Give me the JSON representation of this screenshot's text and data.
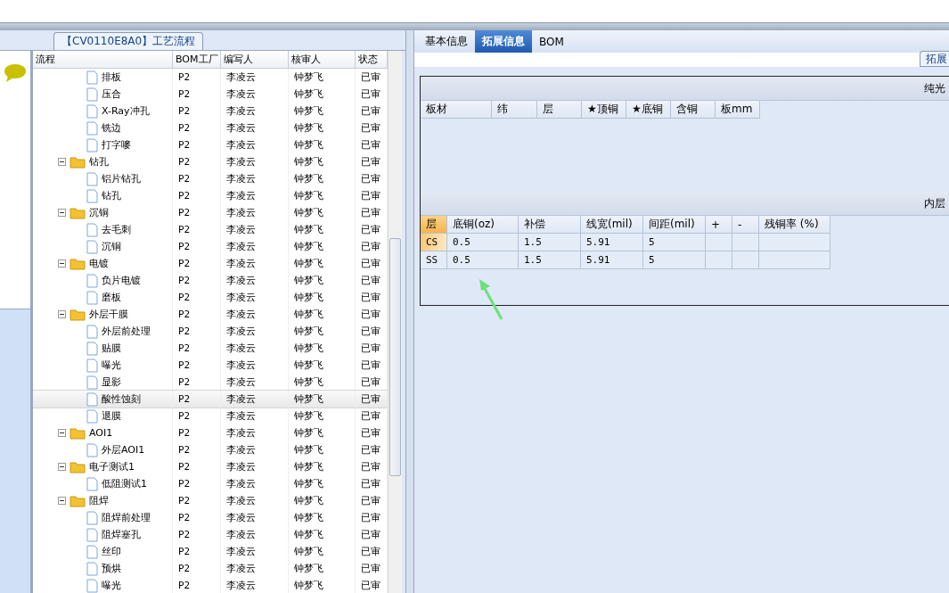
{
  "left_panel": {
    "title": "【CV0110E8A0】工艺流程",
    "columns": [
      "流程",
      "BOM工厂",
      "编写人",
      "核审人",
      "状态"
    ],
    "rows": [
      {
        "kind": "file",
        "label": "排板",
        "bom": "P2",
        "writer": "李凌云",
        "reviewer": "钟梦飞",
        "status": "已审",
        "selected": false
      },
      {
        "kind": "file",
        "label": "压合",
        "bom": "P2",
        "writer": "李凌云",
        "reviewer": "钟梦飞",
        "status": "已审",
        "selected": false
      },
      {
        "kind": "file",
        "label": "X-Ray冲孔",
        "bom": "P2",
        "writer": "李凌云",
        "reviewer": "钟梦飞",
        "status": "已审",
        "selected": false
      },
      {
        "kind": "file",
        "label": "铣边",
        "bom": "P2",
        "writer": "李凌云",
        "reviewer": "钟梦飞",
        "status": "已审",
        "selected": false
      },
      {
        "kind": "file",
        "label": "打字嘜",
        "bom": "P2",
        "writer": "李凌云",
        "reviewer": "钟梦飞",
        "status": "已审",
        "selected": false
      },
      {
        "kind": "folder",
        "label": "钻孔",
        "bom": "P2",
        "writer": "李凌云",
        "reviewer": "钟梦飞",
        "status": "已审",
        "selected": false,
        "expanded": true,
        "children": [
          {
            "kind": "file",
            "label": "铝片钻孔",
            "bom": "P2",
            "writer": "李凌云",
            "reviewer": "钟梦飞",
            "status": "已审",
            "selected": false
          },
          {
            "kind": "file",
            "label": "钻孔",
            "bom": "P2",
            "writer": "李凌云",
            "reviewer": "钟梦飞",
            "status": "已审",
            "selected": false
          }
        ]
      },
      {
        "kind": "folder",
        "label": "沉铜",
        "bom": "P2",
        "writer": "李凌云",
        "reviewer": "钟梦飞",
        "status": "已审",
        "selected": false,
        "expanded": true,
        "children": [
          {
            "kind": "file",
            "label": "去毛刺",
            "bom": "P2",
            "writer": "李凌云",
            "reviewer": "钟梦飞",
            "status": "已审",
            "selected": false
          },
          {
            "kind": "file",
            "label": "沉铜",
            "bom": "P2",
            "writer": "李凌云",
            "reviewer": "钟梦飞",
            "status": "已审",
            "selected": false
          }
        ]
      },
      {
        "kind": "folder",
        "label": "电镀",
        "bom": "P2",
        "writer": "李凌云",
        "reviewer": "钟梦飞",
        "status": "已审",
        "selected": false,
        "expanded": true,
        "children": [
          {
            "kind": "file",
            "label": "负片电镀",
            "bom": "P2",
            "writer": "李凌云",
            "reviewer": "钟梦飞",
            "status": "已审",
            "selected": false
          },
          {
            "kind": "file",
            "label": "磨板",
            "bom": "P2",
            "writer": "李凌云",
            "reviewer": "钟梦飞",
            "status": "已审",
            "selected": false
          }
        ]
      },
      {
        "kind": "folder",
        "label": "外层干膜",
        "bom": "P2",
        "writer": "李凌云",
        "reviewer": "钟梦飞",
        "status": "已审",
        "selected": false,
        "expanded": true,
        "children": [
          {
            "kind": "file",
            "label": "外层前处理",
            "bom": "P2",
            "writer": "李凌云",
            "reviewer": "钟梦飞",
            "status": "已审",
            "selected": false
          },
          {
            "kind": "file",
            "label": "贴膜",
            "bom": "P2",
            "writer": "李凌云",
            "reviewer": "钟梦飞",
            "status": "已审",
            "selected": false
          },
          {
            "kind": "file",
            "label": "曝光",
            "bom": "P2",
            "writer": "李凌云",
            "reviewer": "钟梦飞",
            "status": "已审",
            "selected": false
          },
          {
            "kind": "file",
            "label": "显影",
            "bom": "P2",
            "writer": "李凌云",
            "reviewer": "钟梦飞",
            "status": "已审",
            "selected": false
          },
          {
            "kind": "file",
            "label": "酸性蚀刻",
            "bom": "P2",
            "writer": "李凌云",
            "reviewer": "钟梦飞",
            "status": "已审",
            "selected": true
          },
          {
            "kind": "file",
            "label": "退膜",
            "bom": "P2",
            "writer": "李凌云",
            "reviewer": "钟梦飞",
            "status": "已审",
            "selected": false
          }
        ]
      },
      {
        "kind": "folder",
        "label": "AOI1",
        "bom": "P2",
        "writer": "李凌云",
        "reviewer": "钟梦飞",
        "status": "已审",
        "selected": false,
        "expanded": true,
        "children": [
          {
            "kind": "file",
            "label": "外层AOI1",
            "bom": "P2",
            "writer": "李凌云",
            "reviewer": "钟梦飞",
            "status": "已审",
            "selected": false
          }
        ]
      },
      {
        "kind": "folder",
        "label": "电子测试1",
        "bom": "P2",
        "writer": "李凌云",
        "reviewer": "钟梦飞",
        "status": "已审",
        "selected": false,
        "expanded": true,
        "children": [
          {
            "kind": "file",
            "label": "低阻测试1",
            "bom": "P2",
            "writer": "李凌云",
            "reviewer": "钟梦飞",
            "status": "已审",
            "selected": false
          }
        ]
      },
      {
        "kind": "folder",
        "label": "阻焊",
        "bom": "P2",
        "writer": "李凌云",
        "reviewer": "钟梦飞",
        "status": "已审",
        "selected": false,
        "expanded": true,
        "children": [
          {
            "kind": "file",
            "label": "阻焊前处理",
            "bom": "P2",
            "writer": "李凌云",
            "reviewer": "钟梦飞",
            "status": "已审",
            "selected": false
          },
          {
            "kind": "file",
            "label": "阻焊塞孔",
            "bom": "P2",
            "writer": "李凌云",
            "reviewer": "钟梦飞",
            "status": "已审",
            "selected": false
          },
          {
            "kind": "file",
            "label": "丝印",
            "bom": "P2",
            "writer": "李凌云",
            "reviewer": "钟梦飞",
            "status": "已审",
            "selected": false
          },
          {
            "kind": "file",
            "label": "预烘",
            "bom": "P2",
            "writer": "李凌云",
            "reviewer": "钟梦飞",
            "status": "已审",
            "selected": false
          },
          {
            "kind": "file",
            "label": "曝光",
            "bom": "P2",
            "writer": "李凌云",
            "reviewer": "钟梦飞",
            "status": "已审",
            "selected": false
          }
        ]
      }
    ]
  },
  "right_panel": {
    "tabs": [
      {
        "label": "基本信息",
        "selected": false
      },
      {
        "label": "拓展信息",
        "selected": true
      },
      {
        "label": "BOM",
        "selected": false
      }
    ],
    "corner_button": "拓展",
    "board_section": {
      "title": "纯光",
      "columns": [
        "板材",
        "纬",
        "层",
        "★顶铜",
        "★底铜",
        "含铜",
        "板mm"
      ]
    },
    "inner_section": {
      "title": "内层",
      "columns": [
        "层",
        "底铜(oz)",
        "补偿",
        "线宽(mil)",
        "间距(mil)",
        "+",
        "-",
        "残铜率 (%)"
      ],
      "rows": [
        {
          "selected": true,
          "cells": [
            "CS",
            "0.5",
            "1.5",
            "5.91",
            "5"
          ]
        },
        {
          "selected": false,
          "cells": [
            "SS",
            "0.5",
            "1.5",
            "5.91",
            "5"
          ]
        }
      ]
    }
  }
}
